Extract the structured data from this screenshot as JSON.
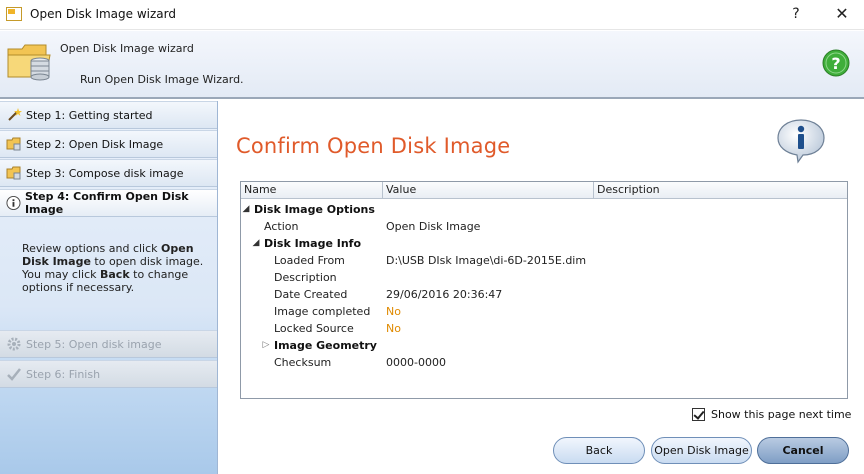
{
  "window": {
    "title": "Open Disk Image wizard",
    "help_glyph": "?",
    "close_glyph": "✕"
  },
  "header": {
    "title": "Open Disk Image wizard",
    "subtitle": "Run Open Disk Image Wizard."
  },
  "sidebar": {
    "steps": [
      {
        "label": "Step 1: Getting started",
        "icon": "wand-icon",
        "state": "normal"
      },
      {
        "label": "Step 2: Open Disk Image",
        "icon": "folder-icon",
        "state": "normal"
      },
      {
        "label": "Step 3: Compose disk image",
        "icon": "folder-icon",
        "state": "normal"
      },
      {
        "label": "Step 4: Confirm Open Disk Image",
        "icon": "info-icon",
        "state": "active"
      },
      {
        "label": "Step 5: Open disk image",
        "icon": "gear-icon",
        "state": "disabled"
      },
      {
        "label": "Step 6: Finish",
        "icon": "checkmark-icon",
        "state": "disabled"
      }
    ],
    "description": {
      "p1": "Review options and click ",
      "b1": "Open Disk Image",
      "p2": " to open disk image. You may click ",
      "b2": "Back",
      "p3": " to change options if necessary."
    }
  },
  "main": {
    "title": "Confirm Open Disk Image",
    "columns": [
      "Name",
      "Value",
      "Description"
    ],
    "rows": [
      {
        "name": "Disk Image Options",
        "value": "",
        "kind": "category",
        "arrow": "◢"
      },
      {
        "name": "Action",
        "value": "Open Disk Image",
        "kind": "item"
      },
      {
        "name": "Disk Image Info",
        "value": "",
        "kind": "category",
        "arrow": "◢"
      },
      {
        "name": "Loaded From",
        "value": "D:\\USB DIsk Image\\di-6D-2015E.dim",
        "kind": "item"
      },
      {
        "name": "Description",
        "value": "",
        "kind": "item"
      },
      {
        "name": "Date Created",
        "value": "29/06/2016 20:36:47",
        "kind": "item"
      },
      {
        "name": "Image completed",
        "value": "No",
        "kind": "item",
        "highlight": true
      },
      {
        "name": "Locked Source",
        "value": "No",
        "kind": "item",
        "highlight": true
      },
      {
        "name": "Image Geometry",
        "value": "",
        "kind": "category",
        "arrow": "▷"
      },
      {
        "name": "Checksum",
        "value": "0000-0000",
        "kind": "item"
      }
    ]
  },
  "footer": {
    "show_page_label": "Show this page next time",
    "show_page_checked": true,
    "back_label": "Back",
    "open_label": "Open Disk Image",
    "cancel_label": "Cancel"
  },
  "colors": {
    "title_accent": "#e05a2a",
    "value_highlight": "#e08a00"
  }
}
